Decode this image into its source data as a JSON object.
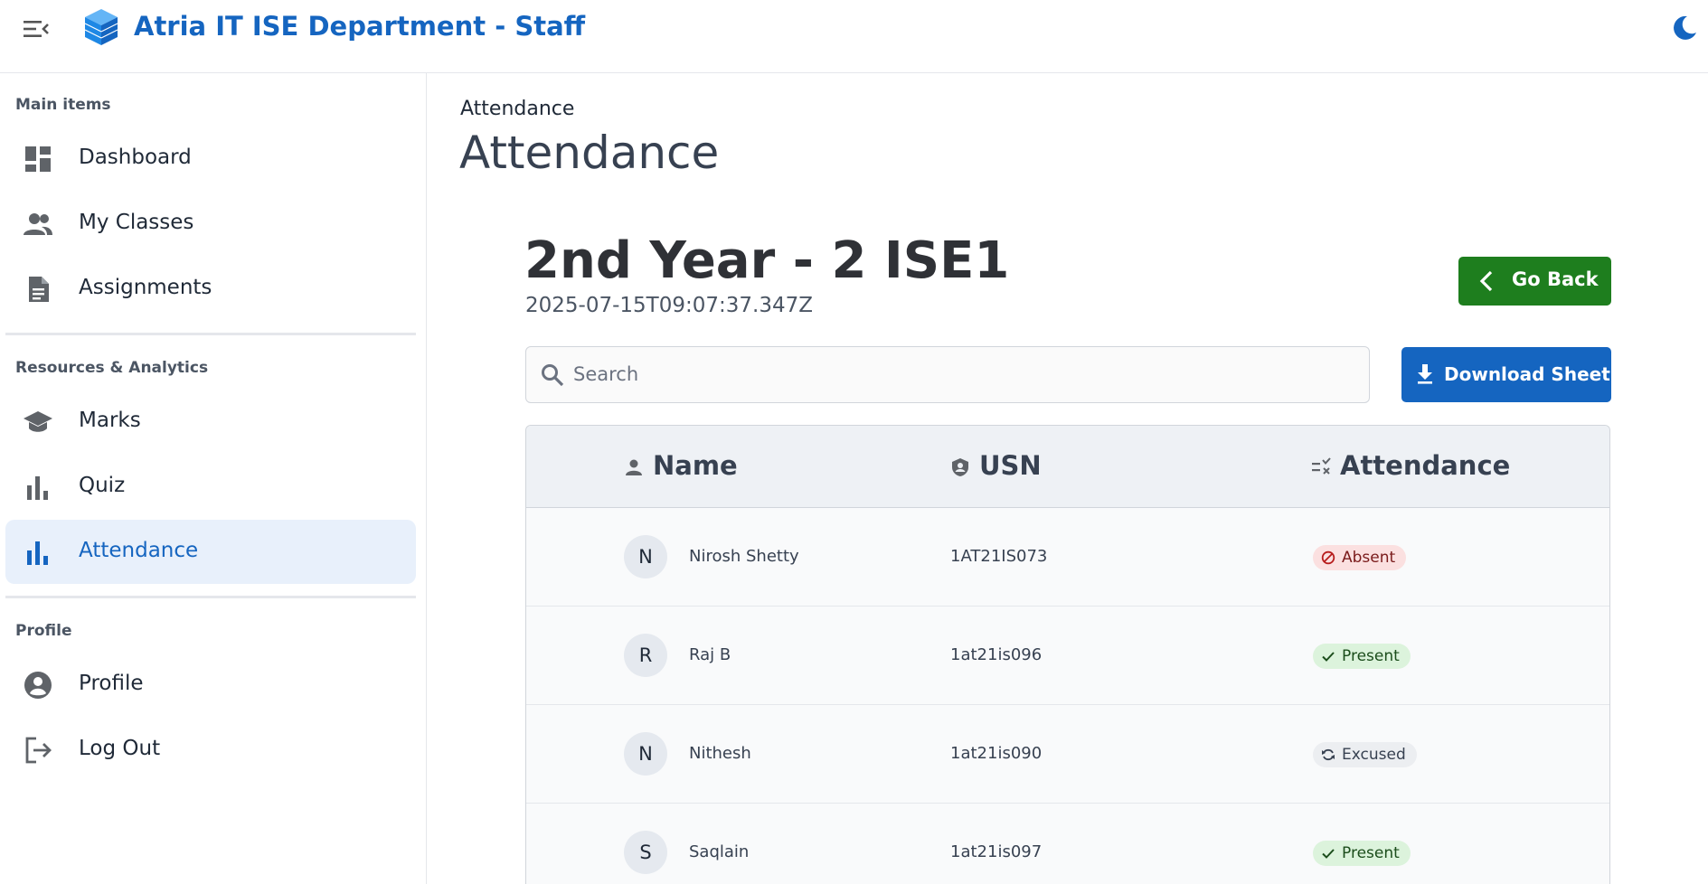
{
  "app": {
    "title": "Atria IT ISE Department - Staff"
  },
  "sidebar": {
    "sections": [
      {
        "label": "Main items"
      },
      {
        "label": "Resources & Analytics"
      },
      {
        "label": "Profile"
      }
    ],
    "items": [
      {
        "label": "Dashboard",
        "icon": "dashboard-icon"
      },
      {
        "label": "My Classes",
        "icon": "people-icon"
      },
      {
        "label": "Assignments",
        "icon": "document-icon"
      },
      {
        "label": "Marks",
        "icon": "school-icon"
      },
      {
        "label": "Quiz",
        "icon": "bar-chart-icon"
      },
      {
        "label": "Attendance",
        "icon": "bar-chart-icon",
        "active": true
      },
      {
        "label": "Profile",
        "icon": "account-circle-icon"
      },
      {
        "label": "Log Out",
        "icon": "logout-icon"
      }
    ]
  },
  "main": {
    "breadcrumb": "Attendance",
    "title": "Attendance",
    "class_title": "2nd Year - 2 ISE1",
    "timestamp": "2025-07-15T09:07:37.347Z",
    "go_back_label": "Go Back",
    "download_label": "Download Sheet",
    "search": {
      "placeholder": "Search",
      "value": ""
    }
  },
  "table": {
    "columns": [
      {
        "label": "Name",
        "icon": "person-icon"
      },
      {
        "label": "USN",
        "icon": "badge-icon"
      },
      {
        "label": "Attendance",
        "icon": "checklist-icon"
      }
    ],
    "rows": [
      {
        "initial": "N",
        "name": "Nirosh Shetty",
        "usn": "1AT21IS073",
        "status": "Absent"
      },
      {
        "initial": "R",
        "name": "Raj B",
        "usn": "1at21is096",
        "status": "Present"
      },
      {
        "initial": "N",
        "name": "Nithesh",
        "usn": "1at21is090",
        "status": "Excused"
      },
      {
        "initial": "S",
        "name": "Saqlain",
        "usn": "1at21is097",
        "status": "Present"
      }
    ]
  },
  "colors": {
    "brand": "#1565c0",
    "go_back": "#1e7e1e",
    "absent_bg": "#fbe0e0",
    "present_bg": "#dcf3dc",
    "excused_bg": "#eceef1"
  }
}
